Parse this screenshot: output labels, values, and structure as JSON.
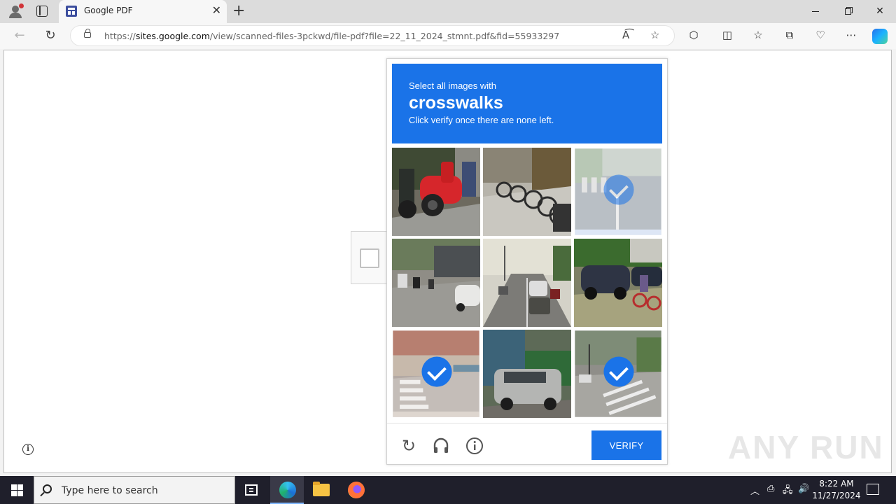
{
  "browser": {
    "tab": {
      "title": "Google PDF"
    },
    "url": {
      "prefix": "https://",
      "host": "sites.google.com",
      "path": "/view/scanned-files-3pckwd/file-pdf?file=22_11_2024_stmnt.pdf&fid=55933297"
    }
  },
  "captcha": {
    "line1": "Select all images with",
    "target": "crosswalks",
    "line3": "Click verify once there are none left.",
    "tiles": [
      {
        "index": 1,
        "selected": false,
        "scene": "red-scooter"
      },
      {
        "index": 2,
        "selected": false,
        "scene": "parked-bicycles"
      },
      {
        "index": 3,
        "selected": true,
        "faded": true,
        "scene": "crosswalk-road"
      },
      {
        "index": 4,
        "selected": false,
        "scene": "busy-street"
      },
      {
        "index": 5,
        "selected": false,
        "scene": "multilane-road"
      },
      {
        "index": 6,
        "selected": false,
        "scene": "parked-cars-cyclist"
      },
      {
        "index": 7,
        "selected": true,
        "scene": "crosswalk-plaza"
      },
      {
        "index": 8,
        "selected": false,
        "scene": "silver-van-truck"
      },
      {
        "index": 9,
        "selected": true,
        "scene": "crosswalk-intersection"
      }
    ],
    "verify_label": "VERIFY"
  },
  "watermark": "ANY RUN",
  "taskbar": {
    "search_placeholder": "Type here to search",
    "time": "8:22 AM",
    "date": "11/27/2024"
  },
  "colors": {
    "accent": "#1a73e8"
  }
}
